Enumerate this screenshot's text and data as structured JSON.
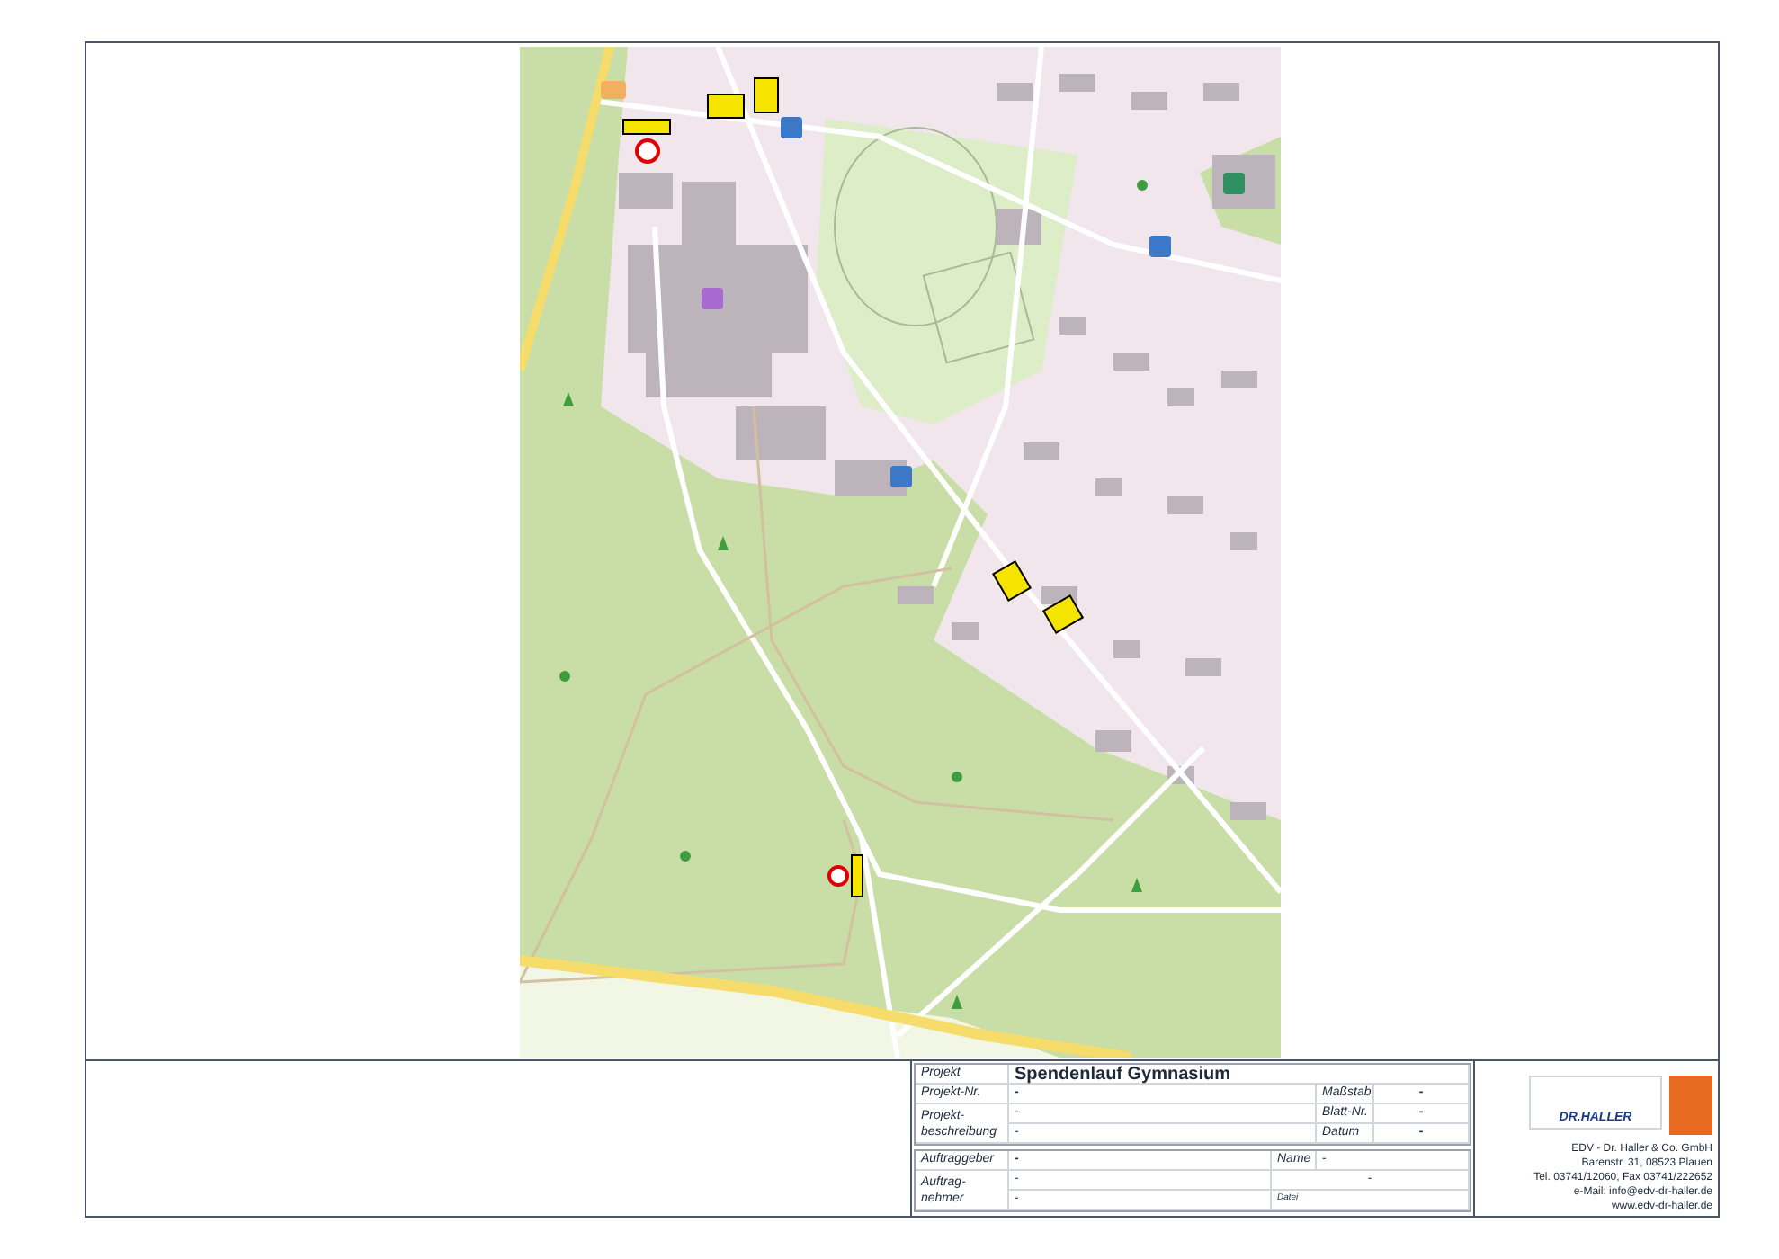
{
  "title_block": {
    "project": {
      "label": "Projekt",
      "value": "Spendenlauf Gymnasium"
    },
    "project_no": {
      "label": "Projekt-Nr.",
      "value": "-"
    },
    "description": {
      "label": "Projekt-beschreibung",
      "lines": [
        "-",
        "-"
      ]
    },
    "scale": {
      "label": "Maßstab",
      "value": "-"
    },
    "sheet_no": {
      "label": "Blatt-Nr.",
      "value": "-"
    },
    "date": {
      "label": "Datum",
      "value": "-"
    },
    "client": {
      "label": "Auftraggeber",
      "value": "-"
    },
    "contractor": {
      "label": "Auftrag-nehmer",
      "lines": [
        "-",
        "-"
      ]
    },
    "name": {
      "label": "Name",
      "value": "-"
    },
    "name_extra": "-",
    "file": {
      "label": "Datei"
    }
  },
  "company": {
    "logo_text": "DR.HALLER",
    "address": [
      "EDV - Dr. Haller & Co. GmbH",
      "Barenstr. 31, 08523 Plauen",
      "Tel. 03741/12060, Fax 03741/222652",
      "e-Mail: info@edv-dr-haller.de",
      "www.edv-dr-haller.de"
    ]
  }
}
